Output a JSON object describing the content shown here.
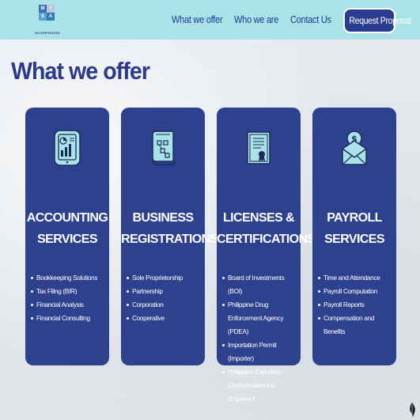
{
  "header": {
    "logo_letters": [
      "M",
      "I",
      "S",
      "A"
    ],
    "logo_subtitle": "INCORPORATED",
    "nav": [
      {
        "label": "What we offer"
      },
      {
        "label": "Who we are"
      },
      {
        "label": "Contact Us"
      }
    ],
    "cta_label": "Request Proposal"
  },
  "page_title": "What we offer",
  "colors": {
    "header_bg": "#a9e3e7",
    "card_bg": "#2e418f",
    "icon_bg": "#a9e3e7",
    "title": "#2c3a8c",
    "cta_bg": "#2b3b8f"
  },
  "cards": [
    {
      "icon": "accounting-tablet-chart-icon",
      "title_lines": [
        "ACCOUNTING",
        "SERVICES"
      ],
      "items": [
        "Bookkeeping Solutions",
        "Tax Filing (BIR)",
        "Financial Analysis",
        "Financial Consulting"
      ]
    },
    {
      "icon": "business-blueprint-scroll-icon",
      "title_lines": [
        "BUSINESS",
        "REGISTRATIONS"
      ],
      "items": [
        "Sole Proprietorship",
        "Partnership",
        "Corporation",
        "Cooperative"
      ]
    },
    {
      "icon": "certificate-award-icon",
      "title_lines": [
        "LICENSES &",
        "CERTIFICATIONS"
      ],
      "items": [
        "Board of Investments (BOI)",
        "Philippine Drug Enforcement Agency (PDEA)",
        "Importation Permit (Importer)",
        "Philippine Exporters Confederation Inc. (Exporter)"
      ]
    },
    {
      "icon": "payroll-envelope-dollar-icon",
      "title_lines": [
        "PAYROLL",
        "SERVICES"
      ],
      "items": [
        "Time and Attendance",
        "Payroll Computation",
        "Payroll Reports",
        "Compensation and Benefits"
      ]
    }
  ]
}
